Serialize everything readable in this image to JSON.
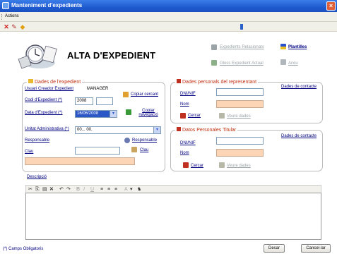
{
  "window": {
    "title": "Manteniment d'expedients",
    "close_label": "×"
  },
  "menubar": {
    "actions_label": "Actions"
  },
  "toolbar": {
    "close_icon": "x-icon",
    "edit_icon": "pencil-icon",
    "star_icon": "diamond-icon"
  },
  "header": {
    "title": "ALTA D'EXPEDIENT",
    "links": {
      "related_expedients": "Expedients Relacionats",
      "templates": "Plantilles",
      "current_expedient_flow": "Gloss Expedient Actual",
      "archive": "Arxiu"
    }
  },
  "expedient": {
    "legend": "Dades de l'expedient",
    "creator_label": "Usuari Creador Expedient",
    "creator_value": "MANAGER",
    "code_label": "Codi d'Expedient (*)",
    "code_year": "2008",
    "code_number": "",
    "copy_search": "Copiar cercant",
    "date_label": "Data d'Expedient (*)",
    "date_value": "16/06/2008",
    "copy_navigating": "Copiar navegació",
    "unit_label": "Unitat Administrativa (*)",
    "unit_value": "00... 00.",
    "responsible_label": "Responsable",
    "responsible_link": "Responsable",
    "key_label": "Clau",
    "key_link": "Clau",
    "key_value": ""
  },
  "representative": {
    "legend": "Dades personals del representant",
    "contact_link": "Dades de contacte",
    "dni_label": "DNI/NIF",
    "name_label": "Nom",
    "search_button": "Cercar",
    "view_data": "Veure dades"
  },
  "holder": {
    "legend": "Datos Personales Titular",
    "contact_link": "Dades de contacte",
    "dni_label": "DNI/NIF",
    "name_label": "Nom",
    "search_button": "Cercar",
    "view_data": "Veure dades"
  },
  "description": {
    "label": "Descripció",
    "toolbar": {
      "cut": "✂",
      "copy": "⎘",
      "paste": "▤",
      "delete": "✕",
      "undo": "↶",
      "redo": "↷",
      "bold": "B",
      "italic": "I",
      "underline": "U",
      "align_left": "≡",
      "align_center": "≡",
      "align_right": "≡",
      "font_color": "A",
      "dropdown": "▾",
      "find": "♞"
    }
  },
  "footer": {
    "required_note": "(*) Camps Obligatoris",
    "save_button": "Desar",
    "cancel_button": "Cancel·lar"
  }
}
